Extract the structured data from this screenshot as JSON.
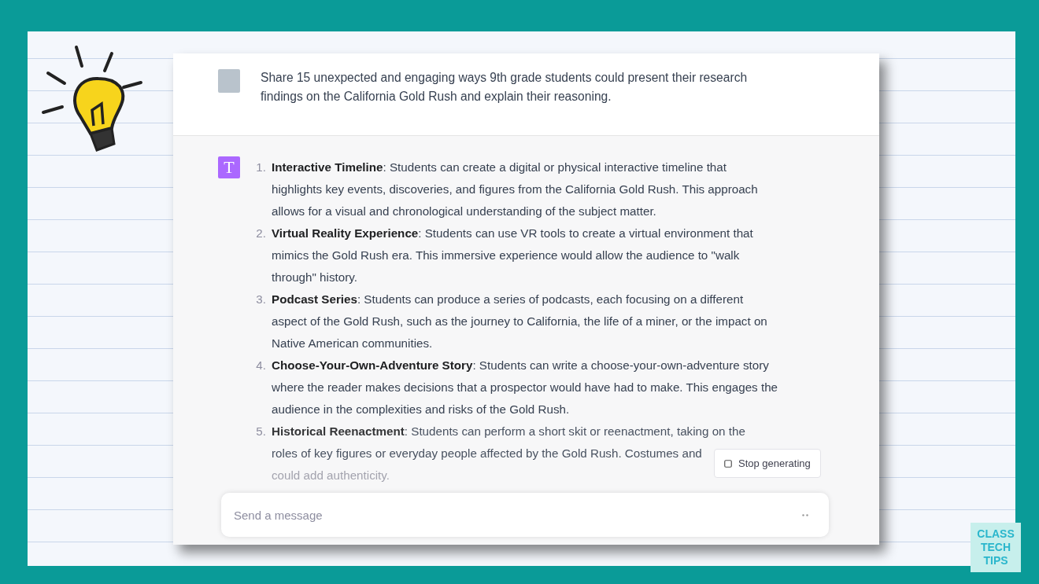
{
  "chat": {
    "prompt": "Share 15 unexpected and engaging ways  9th grade students could present their research findings on the California Gold Rush and explain their reasoning.",
    "answer_icon": "T",
    "items": [
      {
        "number": "1.",
        "text": "**Interactive Timeline**: Students can create a digital or physical interactive timeline that highlights key events, discoveries, and figures from the California Gold Rush. This approach allows for a visual and chronological understanding of the subject matter.",
        "faded": false
      },
      {
        "number": "2.",
        "text": "**Virtual Reality Experience**: Students can use VR tools to create a virtual environment that mimics the Gold Rush era. This immersive experience would allow the audience to \"walk through\" history.",
        "faded": false
      },
      {
        "number": "3.",
        "text": "**Podcast Series**: Students can produce a series of podcasts, each focusing on a different aspect of the Gold Rush, such as the journey to California, the life of a miner, or the impact on Native American communities.",
        "faded": false
      },
      {
        "number": "4.",
        "text": "**Choose-Your-Own-Adventure Story**: Students can write a choose-your-own-adventure story where the reader makes decisions that a prospector would have had to make. This engages the audience in the complexities and risks of the Gold Rush.",
        "faded": false
      },
      {
        "number": "5.",
        "text": "**Historical Reenactment**: Students can perform a short skit or reenactment, taking on the",
        "lines": [
          "roles of key figures or everyday people affected by the Gold Rush. Costumes and",
          "could add authenticity."
        ],
        "faded": true
      }
    ],
    "stop_button": "Stop generating",
    "input": {
      "placeholder": "Send a message"
    }
  },
  "logo": [
    "CLASS",
    "TECH",
    "TIPS"
  ]
}
